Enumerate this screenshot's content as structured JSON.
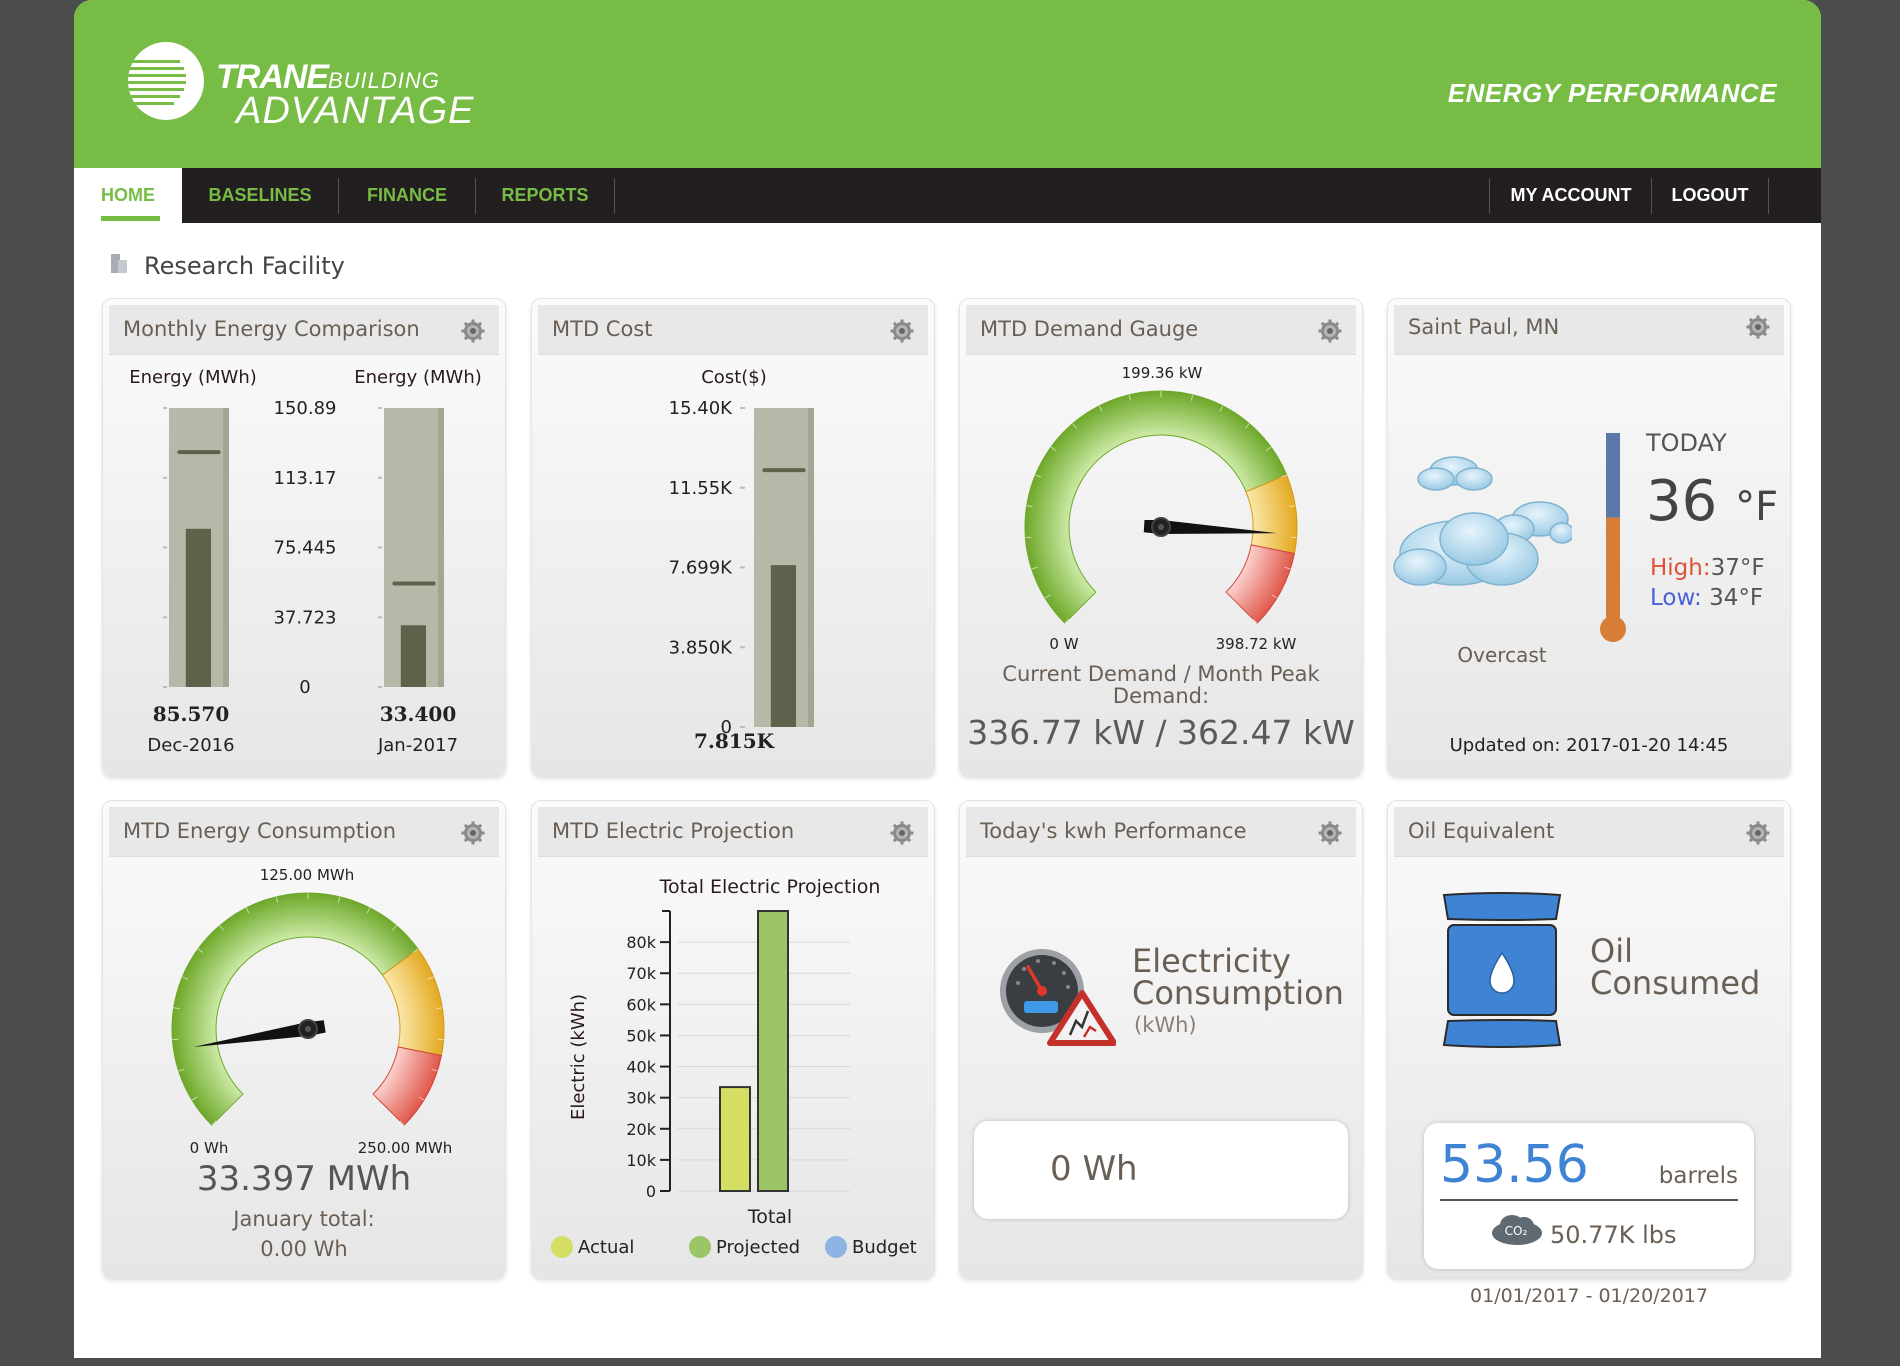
{
  "brand": {
    "logo_line1": "TRANE",
    "logo_line2": "BUILDING",
    "logo_line3": "ADVANTAGE",
    "section_title": "ENERGY PERFORMANCE",
    "accent_color": "#77bc44"
  },
  "nav": {
    "left": [
      {
        "label": "HOME",
        "active": true
      },
      {
        "label": "BASELINES",
        "active": false
      },
      {
        "label": "FINANCE",
        "active": false
      },
      {
        "label": "REPORTS",
        "active": false
      }
    ],
    "right": [
      {
        "label": "MY ACCOUNT"
      },
      {
        "label": "LOGOUT"
      }
    ]
  },
  "breadcrumb": {
    "icon": "building-icon",
    "label": "Research Facility"
  },
  "widgets": {
    "monthly_energy": {
      "title": "Monthly Energy Comparison",
      "axis_label_left": "Energy (MWh)",
      "axis_label_right": "Energy (MWh)",
      "scale_ticks": [
        "150.89",
        "113.17",
        "75.445",
        "37.723",
        "0"
      ],
      "scale_max": 150.89,
      "bars": [
        {
          "value": 85.57,
          "value_label": "85.570",
          "target": 127.0,
          "period": "Dec-2016"
        },
        {
          "value": 33.4,
          "value_label": "33.400",
          "target": 56.0,
          "period": "Jan-2017"
        }
      ]
    },
    "mtd_cost": {
      "title": "MTD Cost",
      "axis_label": "Cost($)",
      "scale_ticks": [
        "15.40K",
        "11.55K",
        "7.699K",
        "3.850K",
        "0"
      ],
      "scale_max": 15400,
      "value": 7815,
      "value_label": "7.815K",
      "target": 12400
    },
    "demand_gauge": {
      "title": "MTD Demand Gauge",
      "min_label": "0 W",
      "mid_label": "199.36 kW",
      "max_label": "398.72 kW",
      "max_value": 398.72,
      "needle_value": 336.77,
      "yellow_from_fraction": 0.75,
      "red_from_fraction": 0.875,
      "caption": "Current Demand / Month Peak Demand:",
      "readout": "336.77 kW / 362.47 kW"
    },
    "weather": {
      "title": "Saint Paul, MN",
      "condition": "Overcast",
      "day_label": "TODAY",
      "temp": "36",
      "unit": "°F",
      "high_label": "High:",
      "high_value": "37°F",
      "low_label": "Low:",
      "low_value": "34°F",
      "updated": "Updated on: 2017-01-20 14:45",
      "thermometer_fill_fraction": 0.55
    },
    "energy_consumption": {
      "title": "MTD Energy Consumption",
      "min_label": "0 Wh",
      "mid_label": "125.00 MWh",
      "max_label": "250.00 MWh",
      "max_value": 250,
      "needle_value": 33.397,
      "yellow_from_fraction": 0.7,
      "red_from_fraction": 0.875,
      "readout": "33.397 MWh",
      "total_label": "January total:",
      "total_value": "0.00 Wh"
    },
    "electric_projection": {
      "title": "MTD Electric Projection"
    },
    "kwh_performance": {
      "title": "Today's kwh Performance",
      "heading_line1": "Electricity",
      "heading_line2": "Consumption",
      "unit": "(kWh)",
      "value": "0 Wh"
    },
    "oil": {
      "title": "Oil Equivalent",
      "heading_line1": "Oil",
      "heading_line2": "Consumed",
      "value": "53.56",
      "unit": "barrels",
      "co2_badge": "CO₂",
      "co2_value": "50.77K lbs",
      "date_range": "01/01/2017 - 01/20/2017"
    }
  },
  "chart_data": {
    "type": "bar",
    "title": "Total Electric Projection",
    "xlabel": "Total",
    "ylabel": "Electric (kWh)",
    "categories": [
      "Total"
    ],
    "ylim": [
      0,
      90000
    ],
    "yticks": [
      0,
      10000,
      20000,
      30000,
      40000,
      50000,
      60000,
      70000,
      80000
    ],
    "ytick_labels": [
      "0",
      "10k",
      "20k",
      "30k",
      "40k",
      "50k",
      "60k",
      "70k",
      "80k"
    ],
    "grid": true,
    "legend_position": "bottom",
    "series": [
      {
        "name": "Actual",
        "color": "#d4de62",
        "values": [
          33400
        ]
      },
      {
        "name": "Projected",
        "color": "#9cc565",
        "values": [
          90000
        ]
      },
      {
        "name": "Budget",
        "color": "#8eb4e3",
        "values": [
          0
        ]
      }
    ]
  }
}
